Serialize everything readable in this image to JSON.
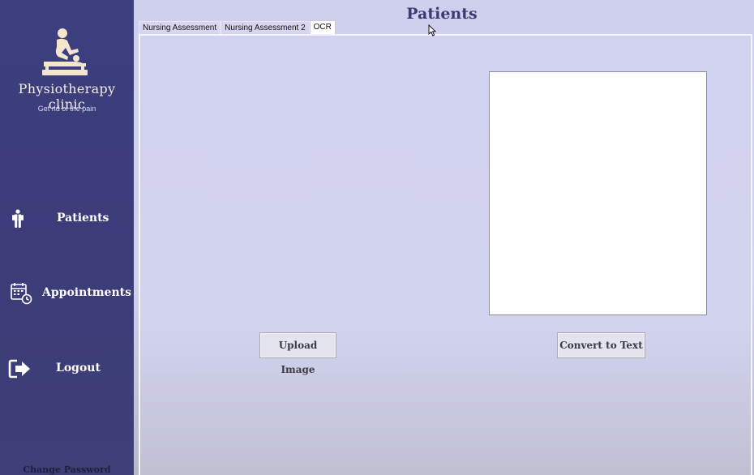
{
  "sidebar": {
    "clinic_name": "Physiotherapy clinic",
    "tagline": "Get rid of the pain",
    "logo_icon": "massage-therapy-icon",
    "nav": [
      {
        "label": "Patients",
        "icon": "person-icon"
      },
      {
        "label": "Appointments",
        "icon": "calendar-clock-icon"
      },
      {
        "label": "Logout",
        "icon": "logout-arrow-icon"
      }
    ],
    "change_password": "Change Password"
  },
  "main": {
    "title": "Patients",
    "tabs": [
      {
        "label": "Nursing Assessment",
        "active": false
      },
      {
        "label": "Nursing Assessment 2",
        "active": false
      },
      {
        "label": "OCR",
        "active": true
      }
    ],
    "ocr": {
      "text_value": "",
      "upload_label": "Upload Image",
      "convert_label": "Convert to Text"
    }
  },
  "colors": {
    "sidebar_bg": "#3d3f7e",
    "main_bg": "#cfd0ee",
    "title_color": "#3a3b74",
    "logo_color": "#f3e6cf"
  }
}
